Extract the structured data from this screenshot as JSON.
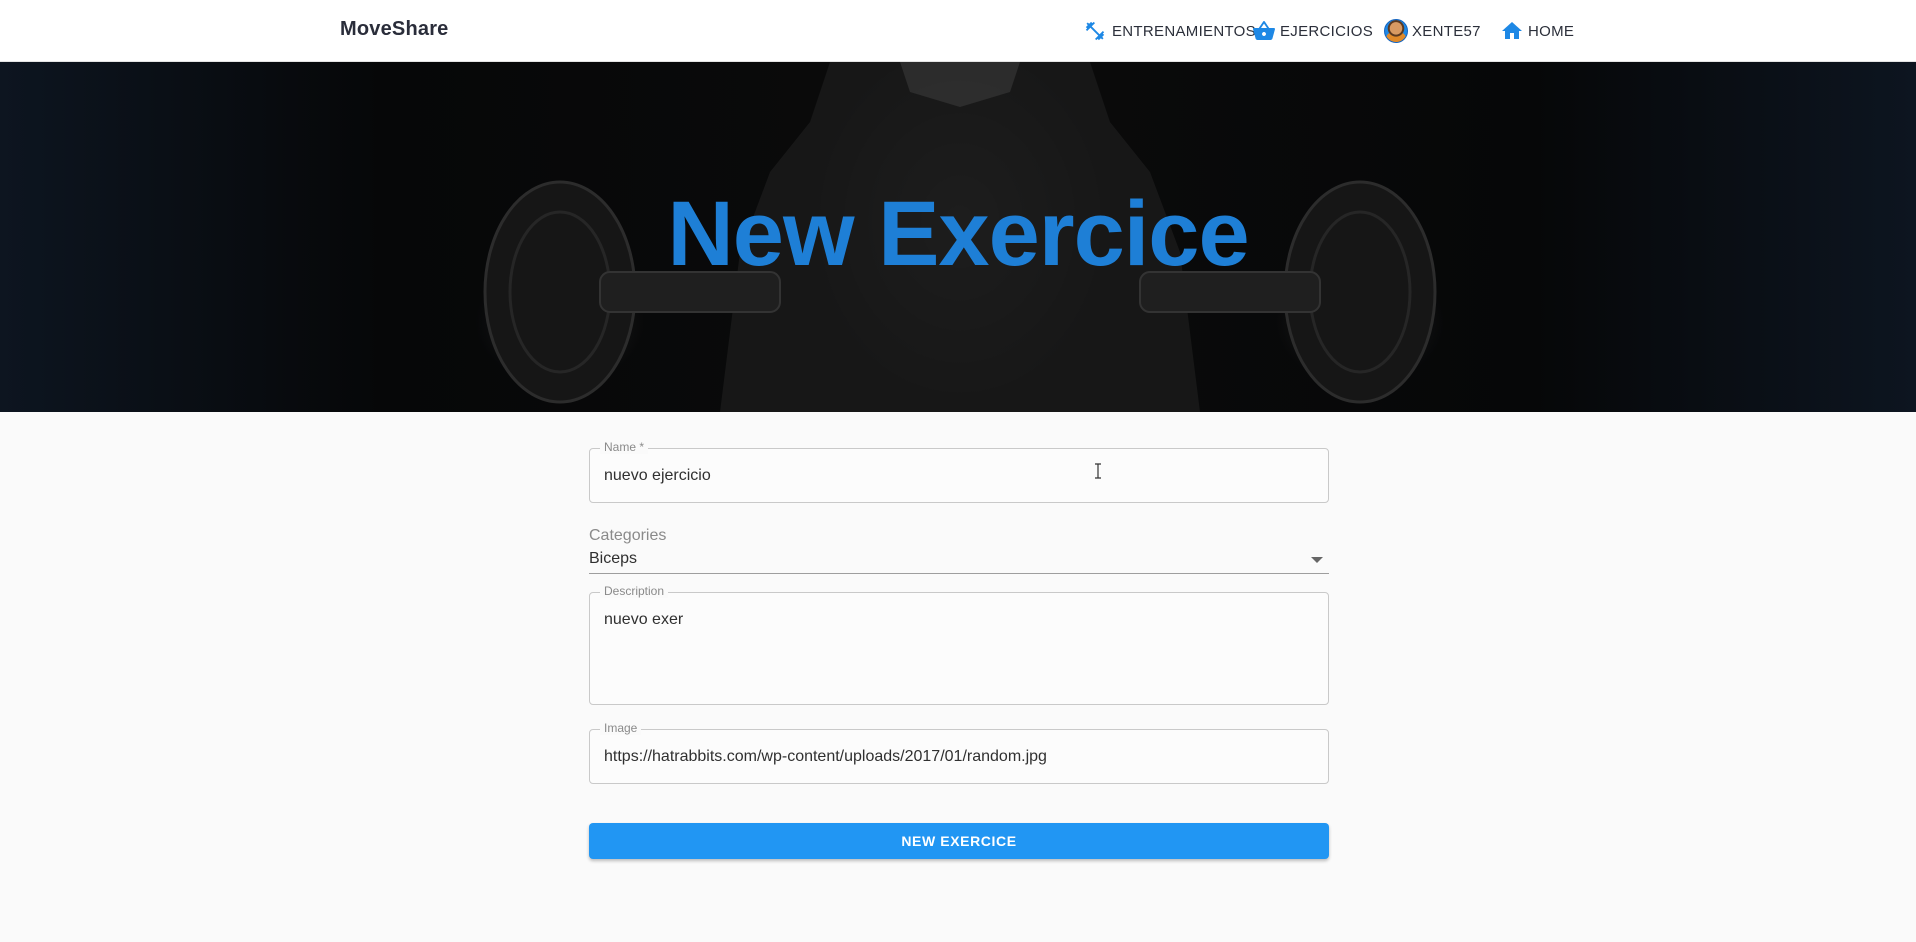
{
  "app": {
    "brand": "MoveShare"
  },
  "nav": {
    "items": [
      {
        "label": "ENTRENAMIENTOS",
        "icon": "dumbbell-icon"
      },
      {
        "label": "EJERCICIOS",
        "icon": "basket-icon"
      },
      {
        "label": "XENTE57",
        "icon": "avatar"
      },
      {
        "label": "HOME",
        "icon": "home-icon"
      }
    ]
  },
  "hero": {
    "title": "New Exercice"
  },
  "form": {
    "name": {
      "label": "Name *",
      "value": "nuevo ejercicio"
    },
    "categories": {
      "label": "Categories",
      "value": "Biceps"
    },
    "description": {
      "label": "Description",
      "value": "nuevo exer"
    },
    "image": {
      "label": "Image",
      "value": "https://hatrabbits.com/wp-content/uploads/2017/01/random.jpg"
    },
    "submit_label": "NEW EXERCICE"
  },
  "colors": {
    "accent": "#2196f3",
    "hero_title": "#1e7fd6",
    "nav_icon": "#1e88e5"
  }
}
